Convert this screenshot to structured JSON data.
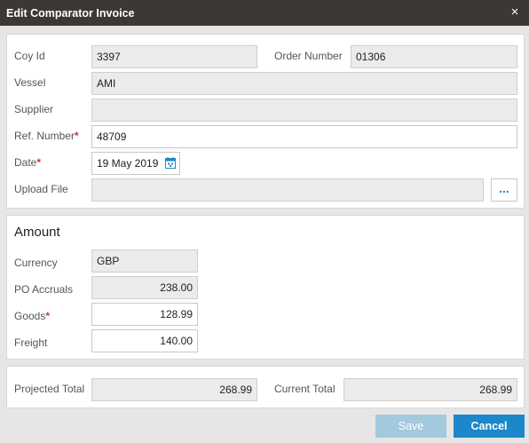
{
  "dialog": {
    "title": "Edit Comparator Invoice",
    "close_glyph": "×"
  },
  "details": {
    "coy_id": {
      "label": "Coy Id",
      "value": "3397"
    },
    "order_number": {
      "label": "Order Number",
      "value": "01306"
    },
    "vessel": {
      "label": "Vessel",
      "value": "AMI"
    },
    "supplier": {
      "label": "Supplier",
      "value": ""
    },
    "ref_number": {
      "label": "Ref. Number",
      "required_mark": "*",
      "value": "48709"
    },
    "date": {
      "label": "Date",
      "required_mark": "*",
      "value": "19 May 2019"
    },
    "upload_file": {
      "label": "Upload File",
      "value": "",
      "browse_label": "..."
    }
  },
  "amount": {
    "title": "Amount",
    "currency": {
      "label": "Currency",
      "value": "GBP"
    },
    "po_accruals": {
      "label": "PO Accruals",
      "value": "238.00"
    },
    "goods": {
      "label": "Goods",
      "required_mark": "*",
      "value": "128.99"
    },
    "freight": {
      "label": "Freight",
      "value": "140.00"
    }
  },
  "totals": {
    "projected": {
      "label": "Projected Total",
      "value": "268.99"
    },
    "current": {
      "label": "Current Total",
      "value": "268.99"
    }
  },
  "footer": {
    "save_label": "Save",
    "cancel_label": "Cancel"
  },
  "colors": {
    "accent": "#1c87c9",
    "accent_disabled": "#a3c9df",
    "required": "#d9302a",
    "titlebar": "#3b3836"
  },
  "icons": {
    "close": "close-icon",
    "date": "calendar-icon"
  }
}
